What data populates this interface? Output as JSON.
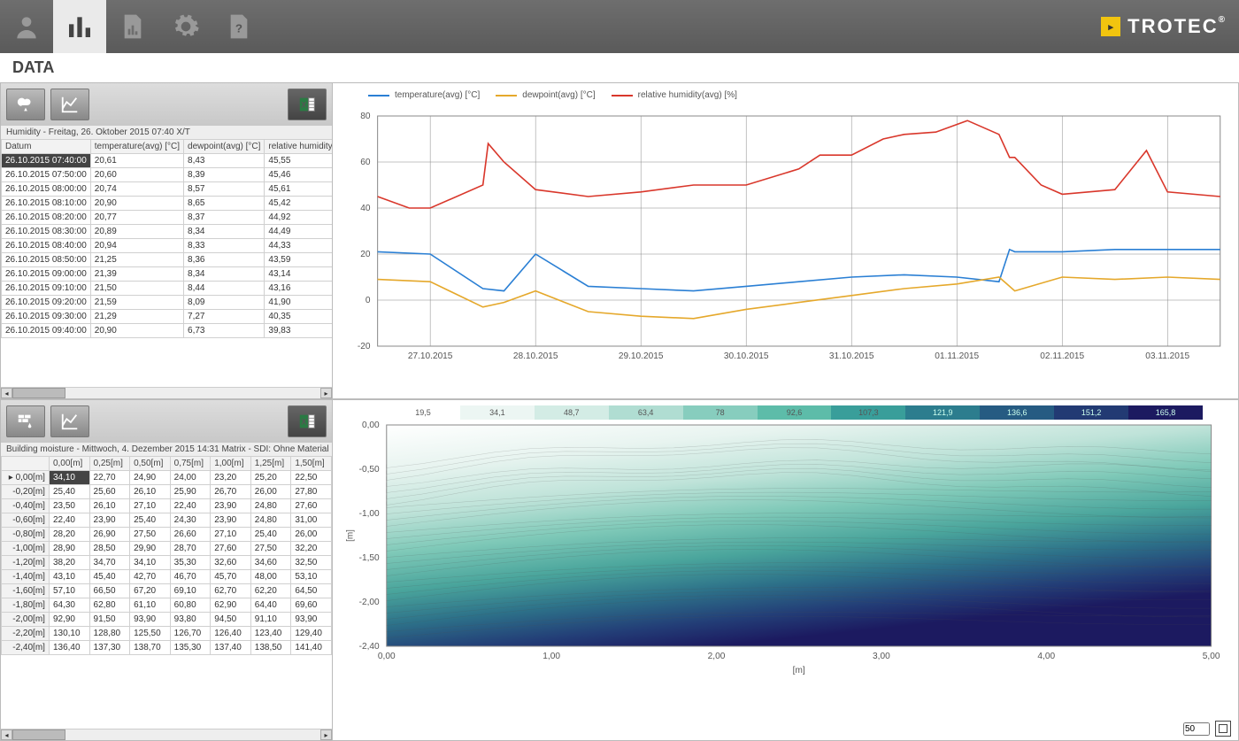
{
  "brand": {
    "name": "TROTEC"
  },
  "page_title": "DATA",
  "panel_top": {
    "caption": "Humidity - Freitag, 26. Oktober 2015 07:40 X/T",
    "table": {
      "headers": [
        "Datum",
        "temperature(avg) [°C]",
        "dewpoint(avg) [°C]",
        "relative humidity(avg) [%]"
      ],
      "rows": [
        [
          "26.10.2015 07:40:00",
          "20,61",
          "8,43",
          "45,55"
        ],
        [
          "26.10.2015 07:50:00",
          "20,60",
          "8,39",
          "45,46"
        ],
        [
          "26.10.2015 08:00:00",
          "20,74",
          "8,57",
          "45,61"
        ],
        [
          "26.10.2015 08:10:00",
          "20,90",
          "8,65",
          "45,42"
        ],
        [
          "26.10.2015 08:20:00",
          "20,77",
          "8,37",
          "44,92"
        ],
        [
          "26.10.2015 08:30:00",
          "20,89",
          "8,34",
          "44,49"
        ],
        [
          "26.10.2015 08:40:00",
          "20,94",
          "8,33",
          "44,33"
        ],
        [
          "26.10.2015 08:50:00",
          "21,25",
          "8,36",
          "43,59"
        ],
        [
          "26.10.2015 09:00:00",
          "21,39",
          "8,34",
          "43,14"
        ],
        [
          "26.10.2015 09:10:00",
          "21,50",
          "8,44",
          "43,16"
        ],
        [
          "26.10.2015 09:20:00",
          "21,59",
          "8,09",
          "41,90"
        ],
        [
          "26.10.2015 09:30:00",
          "21,29",
          "7,27",
          "40,35"
        ],
        [
          "26.10.2015 09:40:00",
          "20,90",
          "6,73",
          "39,83"
        ]
      ]
    }
  },
  "panel_bottom": {
    "caption": "Building moisture - Mittwoch, 4. Dezember 2015 14:31 Matrix - SDI: Ohne Material",
    "table": {
      "col_headers": [
        "0,00[m]",
        "0,25[m]",
        "0,50[m]",
        "0,75[m]",
        "1,00[m]",
        "1,25[m]",
        "1,50[m]"
      ],
      "row_headers": [
        "0,00[m]",
        "-0,20[m]",
        "-0,40[m]",
        "-0,60[m]",
        "-0,80[m]",
        "-1,00[m]",
        "-1,20[m]",
        "-1,40[m]",
        "-1,60[m]",
        "-1,80[m]",
        "-2,00[m]",
        "-2,20[m]",
        "-2,40[m]"
      ],
      "cells": [
        [
          "34,10",
          "22,70",
          "24,90",
          "24,00",
          "23,20",
          "25,20",
          "22,50"
        ],
        [
          "25,40",
          "25,60",
          "26,10",
          "25,90",
          "26,70",
          "26,00",
          "27,80"
        ],
        [
          "23,50",
          "26,10",
          "27,10",
          "22,40",
          "23,90",
          "24,80",
          "27,60"
        ],
        [
          "22,40",
          "23,90",
          "25,40",
          "24,30",
          "23,90",
          "24,80",
          "31,00"
        ],
        [
          "28,20",
          "26,90",
          "27,50",
          "26,60",
          "27,10",
          "25,40",
          "26,00"
        ],
        [
          "28,90",
          "28,50",
          "29,90",
          "28,70",
          "27,60",
          "27,50",
          "32,20"
        ],
        [
          "38,20",
          "34,70",
          "34,10",
          "35,30",
          "32,60",
          "34,60",
          "32,50"
        ],
        [
          "43,10",
          "45,40",
          "42,70",
          "46,70",
          "45,70",
          "48,00",
          "53,10"
        ],
        [
          "57,10",
          "66,50",
          "67,20",
          "69,10",
          "62,70",
          "62,20",
          "64,50"
        ],
        [
          "64,30",
          "62,80",
          "61,10",
          "60,80",
          "62,90",
          "64,40",
          "69,60"
        ],
        [
          "92,90",
          "91,50",
          "93,90",
          "93,80",
          "94,50",
          "91,10",
          "93,90"
        ],
        [
          "130,10",
          "128,80",
          "125,50",
          "126,70",
          "126,40",
          "123,40",
          "129,40"
        ],
        [
          "136,40",
          "137,30",
          "138,70",
          "135,30",
          "137,40",
          "138,50",
          "141,40"
        ]
      ]
    }
  },
  "chart_data": {
    "type": "line",
    "title": "",
    "xlabel": "",
    "ylabel": "",
    "ylim": [
      -20,
      80
    ],
    "x_ticks": [
      "27.10.2015",
      "28.10.2015",
      "29.10.2015",
      "30.10.2015",
      "31.10.2015",
      "01.11.2015",
      "02.11.2015",
      "03.11.2015"
    ],
    "y_ticks": [
      -20,
      0,
      20,
      40,
      60,
      80
    ],
    "series": [
      {
        "name": "temperature(avg) [°C]",
        "color": "#2a7fd4",
        "x": [
          0,
          0.5,
          1,
          1.2,
          1.5,
          2,
          2.5,
          3,
          3.5,
          4,
          4.5,
          5,
          5.5,
          5.9,
          6,
          6.05,
          6.5,
          7,
          7.5,
          8
        ],
        "values": [
          21,
          20,
          5,
          4,
          20,
          6,
          5,
          4,
          6,
          8,
          10,
          11,
          10,
          8,
          22,
          21,
          21,
          22,
          22,
          22
        ]
      },
      {
        "name": "dewpoint(avg) [°C]",
        "color": "#e5a82b",
        "x": [
          0,
          0.5,
          1,
          1.2,
          1.5,
          2,
          2.5,
          3,
          3.5,
          4,
          4.5,
          5,
          5.5,
          5.9,
          6,
          6.05,
          6.5,
          7,
          7.5,
          8
        ],
        "values": [
          9,
          8,
          -3,
          -1,
          4,
          -5,
          -7,
          -8,
          -4,
          -1,
          2,
          5,
          7,
          10,
          6,
          4,
          10,
          9,
          10,
          9
        ]
      },
      {
        "name": "relative humidity(avg) [%]",
        "color": "#d9372b",
        "x": [
          0,
          0.3,
          0.5,
          1,
          1.05,
          1.2,
          1.5,
          2,
          2.5,
          3,
          3.5,
          4,
          4.2,
          4.5,
          4.8,
          5,
          5.3,
          5.6,
          5.9,
          6.0,
          6.05,
          6.3,
          6.5,
          7,
          7.3,
          7.5,
          8
        ],
        "values": [
          45,
          40,
          40,
          50,
          68,
          60,
          48,
          45,
          47,
          50,
          50,
          57,
          63,
          63,
          70,
          72,
          73,
          78,
          72,
          62,
          62,
          50,
          46,
          48,
          65,
          47,
          45
        ]
      }
    ],
    "legend_position": "top"
  },
  "heatmap": {
    "xlabel": "[m]",
    "ylabel": "[m]",
    "x_ticks": [
      "0,00",
      "1,00",
      "2,00",
      "3,00",
      "4,00",
      "5,00"
    ],
    "y_ticks": [
      "0,00",
      "-0,50",
      "-1,00",
      "-1,50",
      "-2,00",
      "-2,40"
    ],
    "colorbar_ticks": [
      "19,5",
      "34,1",
      "48,7",
      "63,4",
      "78",
      "92,6",
      "107,3",
      "121,9",
      "136,6",
      "151,2",
      "165,8"
    ],
    "colorbar_colors": [
      "#ffffff",
      "#ecf6f3",
      "#d3ece5",
      "#b0ddd2",
      "#87cdbe",
      "#5dbca9",
      "#399e9a",
      "#2c7d8e",
      "#265b82",
      "#223a73",
      "#1c1a60"
    ]
  },
  "spinner_value": "50"
}
